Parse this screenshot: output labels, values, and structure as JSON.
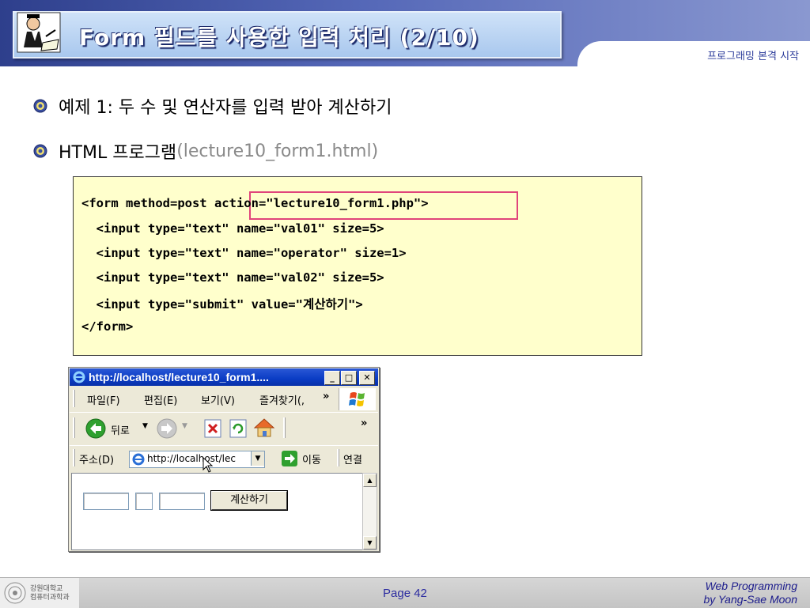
{
  "header": {
    "title": "Form 필드를 사용한 입력 처리 (2/10)",
    "subtitle": "프로그래밍 본격 시작"
  },
  "bullets": [
    {
      "text": "예제 1: 두 수 및 연산자를 입력 받아 계산하기",
      "extra": ""
    },
    {
      "text": "HTML 프로그램 ",
      "extra": "(lecture10_form1.html)"
    }
  ],
  "code": {
    "lines": [
      "<form method=post action=\"lecture10_form1.php\">",
      "  <input type=\"text\" name=\"val01\" size=5>",
      "  <input type=\"text\" name=\"operator\" size=1>",
      "  <input type=\"text\" name=\"val02\" size=5>",
      "  <input type=\"submit\" value=\"계산하기\">",
      "</form>"
    ]
  },
  "browser": {
    "title": "http://localhost/lecture10_form1....",
    "menu": [
      "파일(F)",
      "편집(E)",
      "보기(V)",
      "즐겨찾기(,"
    ],
    "toolbar": {
      "back_label": "뒤로"
    },
    "address": {
      "label": "주소(D)",
      "url": "http://localhost/lec",
      "go_label": "이동",
      "links_label": "연결"
    },
    "form": {
      "submit_label": "계산하기"
    }
  },
  "footer": {
    "page": "Page 42",
    "credit_line1": "Web Programming",
    "credit_line2": "by Yang-Sae Moon",
    "univ_line1": "강원대학교",
    "univ_line2": "컴퓨터과학과"
  },
  "colors": {
    "accent": "#2e3f8c",
    "highlight": "#e0457b",
    "code_bg": "#ffffcc"
  }
}
